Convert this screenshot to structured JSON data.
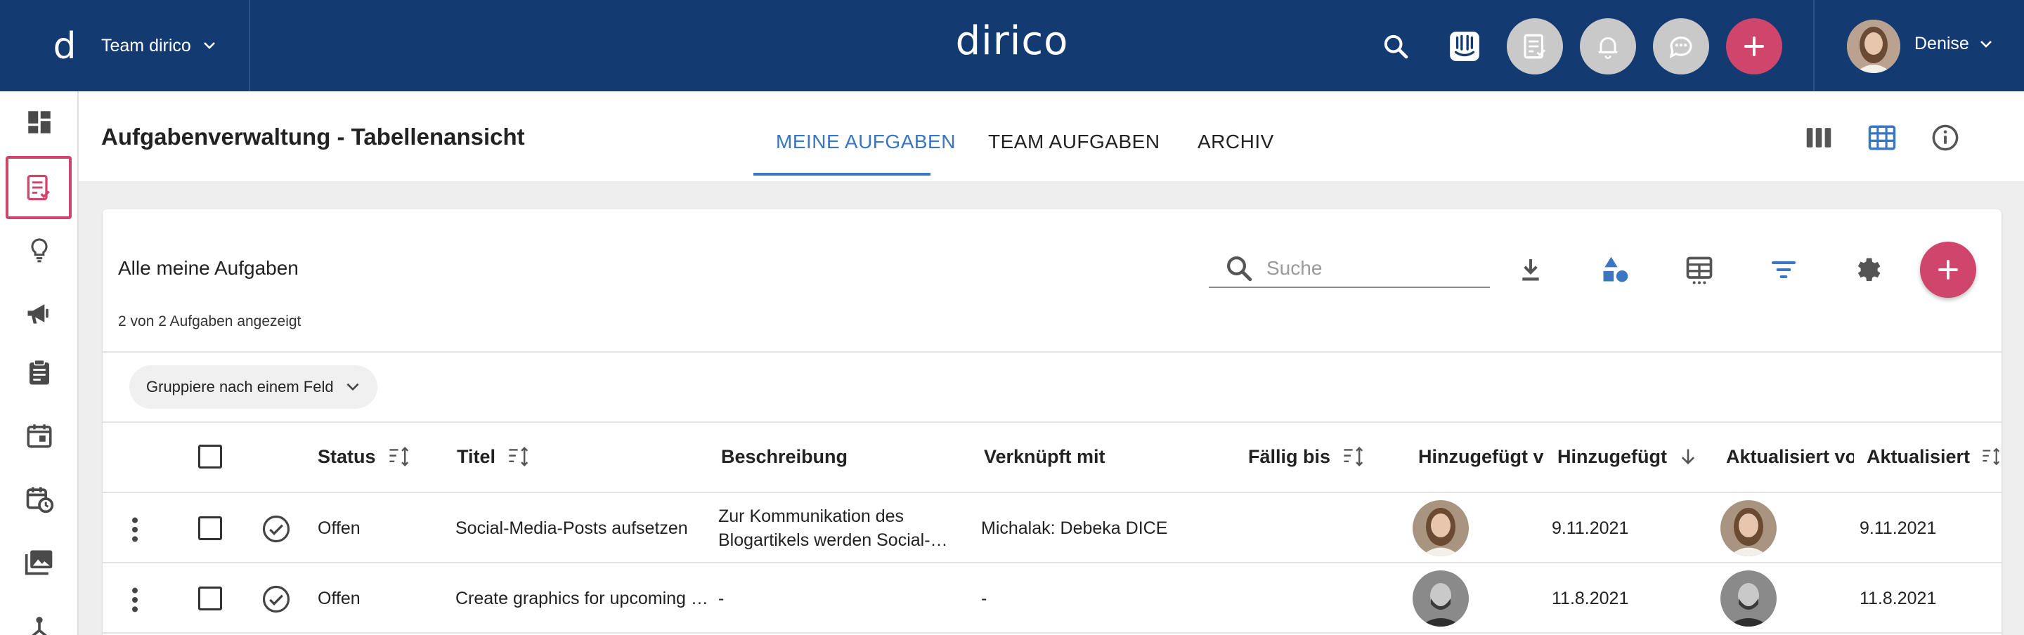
{
  "topbar": {
    "team_label": "Team dirico",
    "brand": "dirico",
    "user_name": "Denise"
  },
  "colors": {
    "topbar": "#143a72",
    "accent": "#3b76c0",
    "fab": "#d0456c"
  },
  "sidebar": {
    "items": [
      {
        "icon": "dashboard-icon"
      },
      {
        "icon": "tasks-icon",
        "active": true
      },
      {
        "icon": "lightbulb-icon"
      },
      {
        "icon": "megaphone-icon"
      },
      {
        "icon": "clipboard-icon"
      },
      {
        "icon": "calendar-icon"
      },
      {
        "icon": "calendar-clock-icon"
      },
      {
        "icon": "media-library-icon"
      },
      {
        "icon": "network-icon"
      }
    ]
  },
  "page": {
    "title": "Aufgabenverwaltung - Tabellenansicht",
    "tabs": [
      {
        "label": "MEINE AUFGABEN",
        "active": true
      },
      {
        "label": "TEAM AUFGABEN"
      },
      {
        "label": "ARCHIV"
      }
    ]
  },
  "card": {
    "title": "Alle meine Aufgaben",
    "count": "2 von 2 Aufgaben angezeigt",
    "search_placeholder": "Suche",
    "group_label": "Gruppiere nach einem Feld"
  },
  "table": {
    "columns": {
      "status": "Status",
      "title": "Titel",
      "description": "Beschreibung",
      "linked": "Verknüpft mit",
      "due": "Fällig bis",
      "added_by": "Hinzugefügt v",
      "added": "Hinzugefügt",
      "updated_by": "Aktualisiert vo",
      "updated": "Aktualisiert"
    },
    "rows": [
      {
        "status": "Offen",
        "title": "Social-Media-Posts aufsetzen",
        "description": "Zur Kommunikation des Blogartikels werden Social-…",
        "linked": "Michalak: Debeka DICE",
        "due": "",
        "added": "9.11.2021",
        "updated": "9.11.2021"
      },
      {
        "status": "Offen",
        "title": "Create graphics for upcoming …",
        "description": "-",
        "linked": "-",
        "due": "",
        "added": "11.8.2021",
        "updated": "11.8.2021"
      }
    ]
  }
}
